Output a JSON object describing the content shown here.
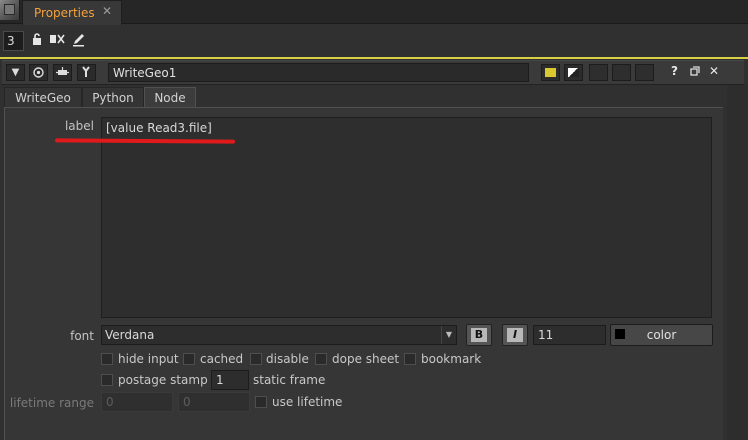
{
  "panel": {
    "tab_label": "Properties",
    "tab_close": "✕"
  },
  "toolbar": {
    "max_panels": "3",
    "icons": [
      "lock-icon",
      "clear-panels-icon",
      "edit-icon"
    ]
  },
  "node": {
    "name": "WriteGeo1",
    "header_icons": [
      "collapse-arrow-icon",
      "preview-icon",
      "node-icon",
      "script-icon"
    ],
    "tile_color": "#d9c830",
    "gl_color": "#ffffff",
    "right_icons": [
      "undo-icon",
      "redo-icon",
      "revert-icon",
      "help-icon",
      "float-icon",
      "close-icon"
    ]
  },
  "tabs": [
    {
      "label": "WriteGeo",
      "active": false
    },
    {
      "label": "Python",
      "active": false
    },
    {
      "label": "Node",
      "active": true
    }
  ],
  "form": {
    "label_caption": "label",
    "label_value": "[value Read3.file]",
    "font_caption": "font",
    "font_value": "Verdana",
    "bold_glyph": "B",
    "italic_glyph": "I",
    "font_size": "11",
    "color_label": "color",
    "color_value": "#000000",
    "checkboxes_row1": [
      {
        "label": "hide input",
        "checked": false
      },
      {
        "label": "cached",
        "checked": false
      },
      {
        "label": "disable",
        "checked": false
      },
      {
        "label": "dope sheet",
        "checked": false
      },
      {
        "label": "bookmark",
        "checked": false
      }
    ],
    "postage_stamp": {
      "label": "postage stamp",
      "checked": false
    },
    "static_frame_value": "1",
    "static_frame_label": "static frame",
    "lifetime_caption": "lifetime range",
    "lifetime_start": "0",
    "lifetime_end": "0",
    "use_lifetime": {
      "label": "use lifetime",
      "checked": false
    }
  },
  "colors": {
    "accent_tab": "#f3a13b",
    "node_separator": "#d8cf45",
    "annotation_mark": "#e01a1a"
  }
}
